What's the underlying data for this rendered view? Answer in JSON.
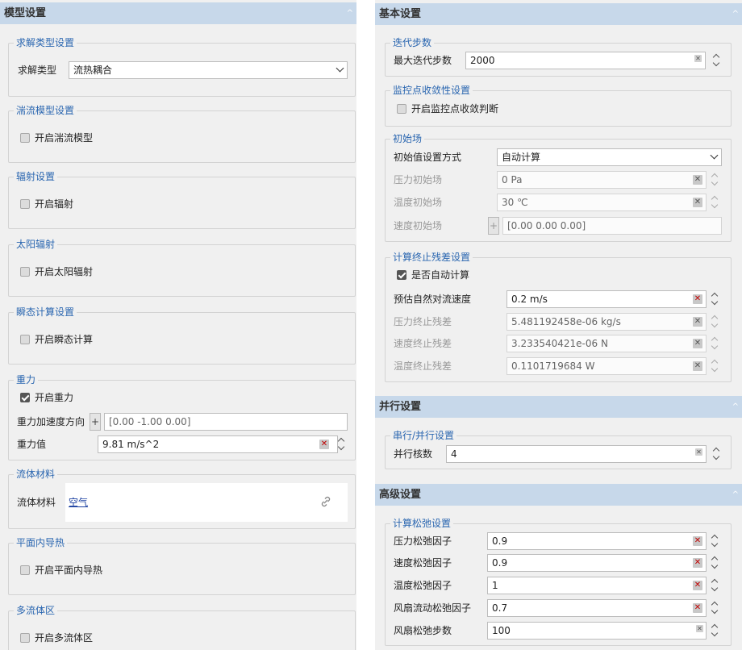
{
  "left": {
    "title": "模型设置",
    "solve": {
      "group": "求解类型设置",
      "label": "求解类型",
      "value": "流热耦合"
    },
    "turbulence": {
      "group": "湍流模型设置",
      "check": "开启湍流模型"
    },
    "radiation": {
      "group": "辐射设置",
      "check": "开启辐射"
    },
    "solar": {
      "group": "太阳辐射",
      "check": "开启太阳辐射"
    },
    "transient": {
      "group": "瞬态计算设置",
      "check": "开启瞬态计算"
    },
    "gravity": {
      "group": "重力",
      "check": "开启重力",
      "dir_label": "重力加速度方向",
      "dir_value": "[0.00 -1.00 0.00]",
      "val_label": "重力值",
      "val_value": "9.81 m/s^2"
    },
    "fluid": {
      "group": "流体材料",
      "label": "流体材料",
      "link": "空气"
    },
    "inplane": {
      "group": "平面内导热",
      "check": "开启平面内导热"
    },
    "multifluid": {
      "group": "多流体区",
      "check": "开启多流体区"
    }
  },
  "right": {
    "basic_title": "基本设置",
    "iter": {
      "group": "迭代步数",
      "label": "最大迭代步数",
      "value": "2000"
    },
    "monitor": {
      "group": "监控点收敛性设置",
      "check": "开启监控点收敛判断"
    },
    "init": {
      "group": "初始场",
      "mode_label": "初始值设置方式",
      "mode_value": "自动计算",
      "p_label": "压力初始场",
      "p_value": "0 Pa",
      "t_label": "温度初始场",
      "t_value": "30 ℃",
      "v_label": "速度初始场",
      "v_value": "[0.00 0.00 0.00]"
    },
    "resid": {
      "group": "计算终止残差设置",
      "check": "是否自动计算",
      "nat_label": "预估自然对流速度",
      "nat_value": "0.2 m/s",
      "p_label": "压力终止残差",
      "p_value": "5.481192458e-06 kg/s",
      "v_label": "速度终止残差",
      "v_value": "3.233540421e-06 N",
      "t_label": "温度终止残差",
      "t_value": "0.1101719684 W"
    },
    "parallel_title": "并行设置",
    "parallel": {
      "group": "串行/并行设置",
      "label": "并行核数",
      "value": "4"
    },
    "advanced_title": "高级设置",
    "relax": {
      "group": "计算松弛设置",
      "items": [
        {
          "label": "压力松弛因子",
          "value": "0.9"
        },
        {
          "label": "速度松弛因子",
          "value": "0.9"
        },
        {
          "label": "温度松弛因子",
          "value": "1"
        },
        {
          "label": "风扇流动松弛因子",
          "value": "0.7"
        },
        {
          "label": "风扇松弛步数",
          "value": "100"
        }
      ]
    }
  },
  "icons": {
    "clear": "×",
    "link": "link-icon"
  }
}
